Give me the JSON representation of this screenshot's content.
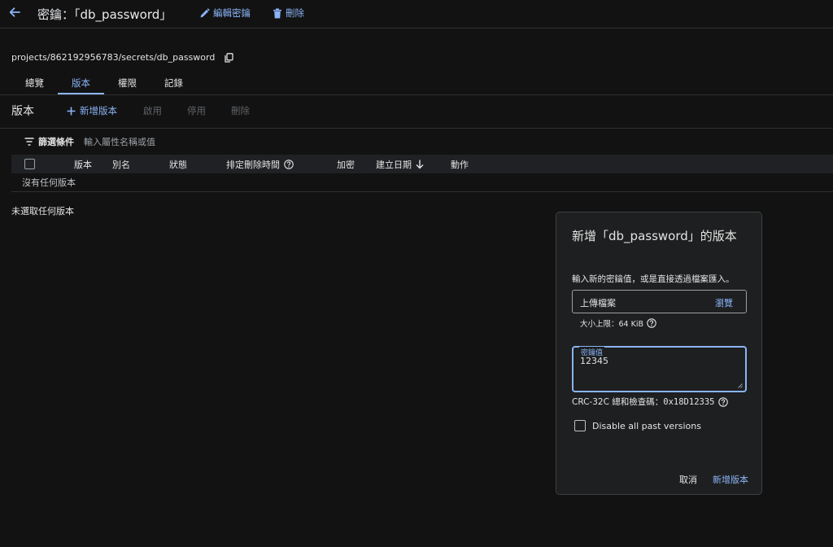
{
  "header": {
    "title": "密鑰：「db_password」",
    "edit_label": "編輯密鑰",
    "delete_label": "刪除"
  },
  "resource_path": "projects/862192956783/secrets/db_password",
  "tabs": [
    {
      "label": "總覽",
      "active": false
    },
    {
      "label": "版本",
      "active": true
    },
    {
      "label": "權限",
      "active": false
    },
    {
      "label": "記錄",
      "active": false
    }
  ],
  "versions": {
    "title": "版本",
    "add_label": "新增版本",
    "enable_label": "啟用",
    "disable_label": "停用",
    "delete_label": "刪除"
  },
  "filter": {
    "label": "篩選條件",
    "placeholder": "輸入屬性名稱或值"
  },
  "table": {
    "columns": [
      "版本",
      "別名",
      "狀態",
      "排定刪除時間",
      "加密",
      "建立日期"
    ],
    "action_column": "動作",
    "empty_text": "沒有任何版本",
    "sort_column": "建立日期"
  },
  "selection_text": "未選取任何版本",
  "dialog": {
    "title": "新增「db_password」的版本",
    "description": "輸入新的密鑰值，或是直接透過檔案匯入。",
    "upload_label": "上傳檔案",
    "browse_label": "瀏覽",
    "size_limit": "大小上限：64 KiB",
    "secret_label": "密鑰值",
    "secret_value": "12345",
    "crc_label": "CRC-32C 總和檢查碼：",
    "crc_value": "0x18D12335",
    "disable_checkbox_label": "Disable all past versions",
    "disable_checked": false,
    "cancel_label": "取消",
    "submit_label": "新增版本"
  },
  "colors": {
    "background": "#121212",
    "accent": "#8ab4f8",
    "dialog_bg": "#1e1f20",
    "text": "#e3e3e3",
    "disabled": "#5f6368"
  }
}
